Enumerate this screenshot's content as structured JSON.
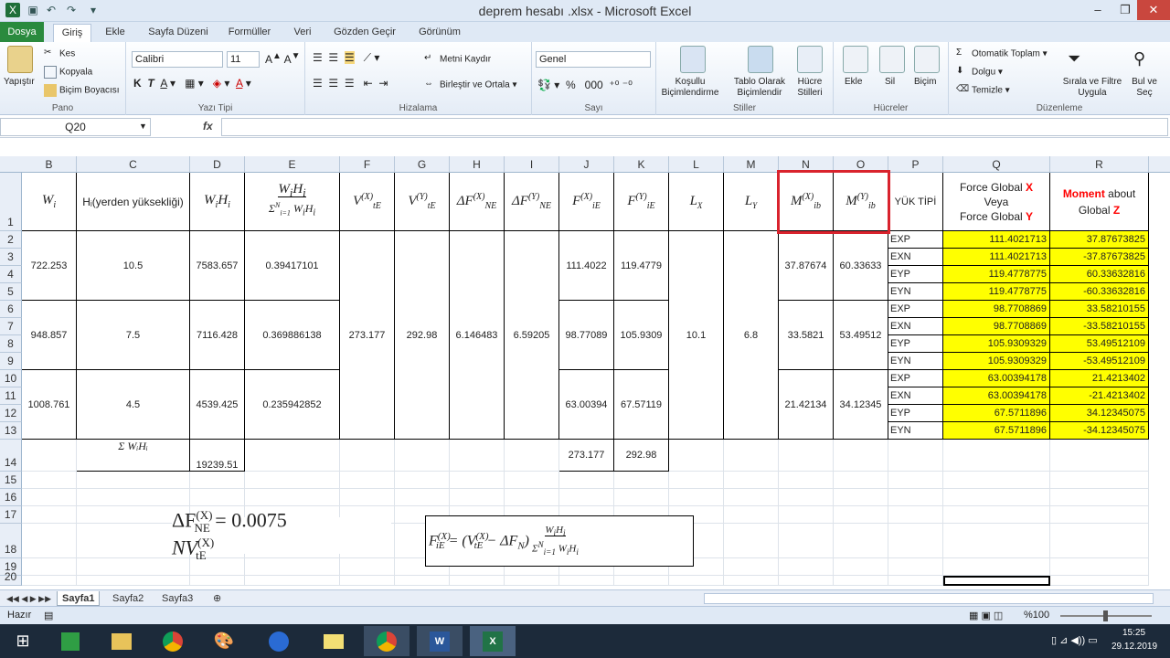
{
  "window": {
    "title": "deprem hesabı .xlsx  -  Microsoft Excel"
  },
  "menu": {
    "file": "Dosya",
    "tabs": [
      "Giriş",
      "Ekle",
      "Sayfa Düzeni",
      "Formüller",
      "Veri",
      "Gözden Geçir",
      "Görünüm"
    ]
  },
  "ribbon": {
    "pano": {
      "label": "Pano",
      "paste": "Yapıştır",
      "cut": "Kes",
      "copy": "Kopyala",
      "format_painter": "Biçim Boyacısı"
    },
    "font": {
      "label": "Yazı Tipi",
      "name": "Calibri",
      "size": "11"
    },
    "align": {
      "label": "Hizalama",
      "wrap": "Metni Kaydır",
      "merge": "Birleştir ve Ortala"
    },
    "number": {
      "label": "Sayı",
      "format": "Genel"
    },
    "styles": {
      "label": "Stiller",
      "conditional": "Koşullu\nBiçimlendirme",
      "table": "Tablo Olarak\nBiçimlendir",
      "cell": "Hücre\nStilleri"
    },
    "cells": {
      "label": "Hücreler",
      "insert": "Ekle",
      "delete": "Sil",
      "format": "Biçim"
    },
    "editing": {
      "label": "Düzenleme",
      "autosum": "Otomatik Toplam",
      "fill": "Dolgu",
      "clear": "Temizle",
      "sort": "Sırala ve Filtre\nUygula",
      "find": "Bul ve\nSeç"
    }
  },
  "formula_bar": {
    "name_box": "Q20",
    "fx": "fx",
    "value": ""
  },
  "columns": [
    "B",
    "C",
    "D",
    "E",
    "F",
    "G",
    "H",
    "I",
    "J",
    "K",
    "L",
    "M",
    "N",
    "O",
    "P",
    "Q",
    "R"
  ],
  "rows": [
    "1",
    "2",
    "3",
    "4",
    "5",
    "6",
    "7",
    "8",
    "9",
    "10",
    "11",
    "12",
    "13",
    "14",
    "15",
    "16",
    "17",
    "18",
    "19",
    "20"
  ],
  "headers": {
    "B": "Wᵢ",
    "C": "Hᵢ(yerden yüksekliği)",
    "D": "WᵢHᵢ",
    "E": "WᵢHᵢ / Σᵢ₌₁ᴺ WᵢHᵢ",
    "F": "V(X) tE",
    "G": "V(Y) tE",
    "H": "ΔF(X) NE",
    "I": "ΔF(Y) NE",
    "J": "F(X) iE",
    "K": "F(Y) iE",
    "L": "Lₓ",
    "M": "Lᵧ",
    "N": "M(X) ib",
    "O": "M(Y) ib",
    "P": "YÜK TİPİ",
    "Q1": "Force Global ",
    "Q1b": "X",
    "Q2": "Veya",
    "Q3": "Force Global ",
    "Q3b": "Y",
    "R1": "Moment",
    "R1b": " about",
    "R2": "Global ",
    "R2b": "Z"
  },
  "floors": [
    {
      "W": "722.253",
      "H": "10.5",
      "WH": "7583.657",
      "ratio": "0.39417101",
      "Fx": "111.4022",
      "Fy": "119.4779",
      "Mx": "37.87674",
      "My": "60.33633"
    },
    {
      "W": "948.857",
      "H": "7.5",
      "WH": "7116.428",
      "ratio": "0.369886138",
      "Fx": "98.77089",
      "Fy": "105.9309",
      "Mx": "33.5821",
      "My": "53.49512"
    },
    {
      "W": "1008.761",
      "H": "4.5",
      "WH": "4539.425",
      "ratio": "0.235942852",
      "Fx": "63.00394",
      "Fy": "67.57119",
      "Mx": "21.42134",
      "My": "34.12345"
    }
  ],
  "shared": {
    "Vx": "273.177",
    "Vy": "292.98",
    "dFx": "6.146483",
    "dFy": "6.59205",
    "Lx": "10.1",
    "Ly": "6.8"
  },
  "loads": [
    {
      "type": "EXP",
      "Q": "111.4021713",
      "R": "37.87673825"
    },
    {
      "type": "EXN",
      "Q": "111.4021713",
      "R": "-37.87673825"
    },
    {
      "type": "EYP",
      "Q": "119.4778775",
      "R": "60.33632816"
    },
    {
      "type": "EYN",
      "Q": "119.4778775",
      "R": "-60.33632816"
    },
    {
      "type": "EXP",
      "Q": "98.7708869",
      "R": "33.58210155"
    },
    {
      "type": "EXN",
      "Q": "98.7708869",
      "R": "-33.58210155"
    },
    {
      "type": "EYP",
      "Q": "105.9309329",
      "R": "53.49512109"
    },
    {
      "type": "EYN",
      "Q": "105.9309329",
      "R": "-53.49512109"
    },
    {
      "type": "EXP",
      "Q": "63.00394178",
      "R": "21.4213402"
    },
    {
      "type": "EXN",
      "Q": "63.00394178",
      "R": "-21.4213402"
    },
    {
      "type": "EYP",
      "Q": "67.5711896",
      "R": "34.12345075"
    },
    {
      "type": "EYN",
      "Q": "67.5711896",
      "R": "-34.12345075"
    }
  ],
  "totals": {
    "sum_label": "Σ WᵢHᵢ",
    "WH": "19239.51",
    "Fx": "273.177",
    "Fy": "292.98"
  },
  "formulas": {
    "f1": "ΔF(X)NE = 0.0075 N V(X)tE",
    "f2": "F(X)iE = (V(X)tE − ΔFN) · WᵢHᵢ / Σᵢ₌₁ᴺ WᵢHᵢ"
  },
  "sheets": [
    "Sayfa1",
    "Sayfa2",
    "Sayfa3"
  ],
  "status": {
    "ready": "Hazır",
    "zoom": "%100"
  },
  "taskbar": {
    "time": "15:25",
    "date": "29.12.2019"
  },
  "colors": {
    "highlight_box": "#d9232d",
    "yellow": "#ffff00",
    "red_text": "#ff0000"
  }
}
